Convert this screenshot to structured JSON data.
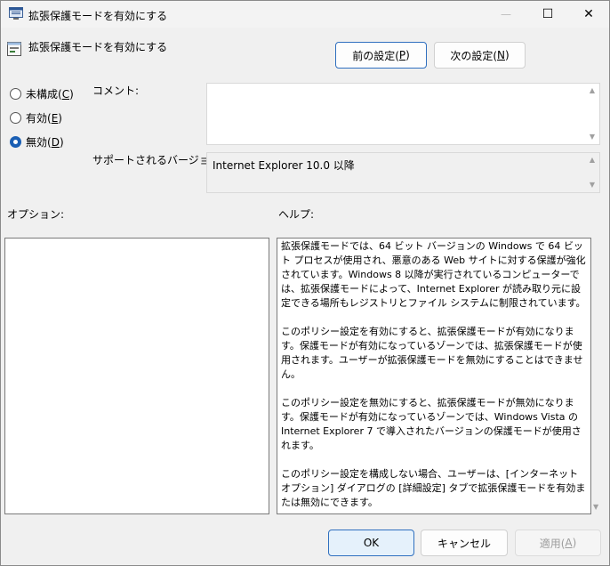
{
  "window": {
    "title": "拡張保護モードを有効にする",
    "icon": "policy-window-icon",
    "controls": {
      "minimize": "—",
      "maximize": "☐",
      "close": "✕"
    }
  },
  "policy": {
    "name": "拡張保護モードを有効にする",
    "icon": "policy-setting-icon"
  },
  "nav": {
    "prev_label": "前の設定(",
    "prev_key": "P",
    "next_label": "次の設定(",
    "next_key": "N"
  },
  "state": {
    "options": [
      {
        "label": "未構成(",
        "key": "C",
        "checked": false
      },
      {
        "label": "有効(",
        "key": "E",
        "checked": false
      },
      {
        "label": "無効(",
        "key": "D",
        "checked": true
      }
    ]
  },
  "comment": {
    "label": "コメント:",
    "value": ""
  },
  "supported": {
    "label": "サポートされるバージョン:",
    "value": "Internet Explorer 10.0 以降"
  },
  "options_section": {
    "label": "オプション:"
  },
  "help": {
    "label": "ヘルプ:",
    "paragraphs": [
      "拡張保護モードでは、64 ビット バージョンの Windows で 64 ビット プロセスが使用され、悪意のある Web サイトに対する保護が強化されています。Windows 8 以降が実行されているコンピューターでは、拡張保護モードによって、Internet Explorer が読み取り元に設定できる場所もレジストリとファイル システムに制限されています。",
      "このポリシー設定を有効にすると、拡張保護モードが有効になります。保護モードが有効になっているゾーンでは、拡張保護モードが使用されます。ユーザーが拡張保護モードを無効にすることはできません。",
      "このポリシー設定を無効にすると、拡張保護モードが無効になります。保護モードが有効になっているゾーンでは、Windows Vista の Internet Explorer 7 で導入されたバージョンの保護モードが使用されます。",
      "このポリシー設定を構成しない場合、ユーザーは、[インターネット オプション] ダイアログの [詳細設定] タブで拡張保護モードを有効または無効にできます。"
    ]
  },
  "footer": {
    "ok_label": "OK",
    "cancel_label": "キャンセル",
    "apply_label": "適用(",
    "apply_key": "A"
  },
  "colors": {
    "accent": "#1a5fb4",
    "window_bg": "#f0f0f0",
    "ok_bg": "#e5f1fb"
  }
}
